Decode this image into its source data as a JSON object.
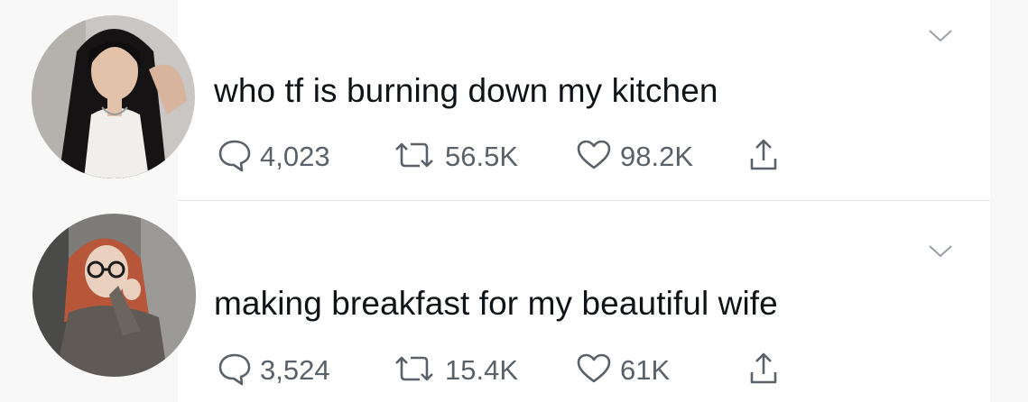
{
  "tweets": [
    {
      "text": "who tf is burning down my kitchen",
      "replies": "4,023",
      "retweets": "56.5K",
      "likes": "98.2K"
    },
    {
      "text": "making breakfast for my beautiful wife",
      "replies": "3,524",
      "retweets": "15.4K",
      "likes": "61K"
    }
  ],
  "icons": {
    "reply": "speech-bubble-icon",
    "retweet": "retweet-arrows-icon",
    "like": "heart-outline-icon",
    "share": "share-upload-icon",
    "menu": "chevron-down-icon"
  },
  "colors": {
    "text": "#101418",
    "muted": "#5a6169",
    "card": "#ffffff",
    "background": "#f8f8f8",
    "divider": "#e4e4e4"
  }
}
